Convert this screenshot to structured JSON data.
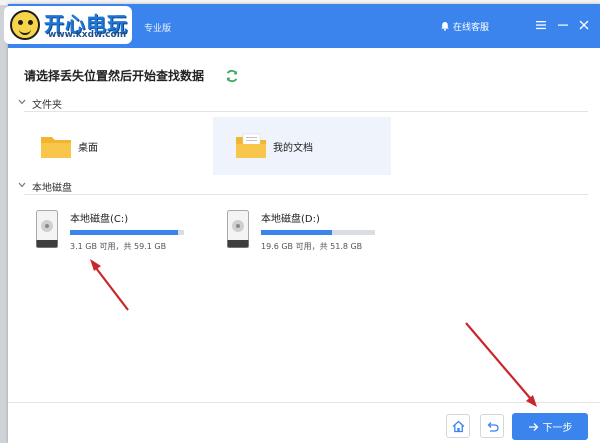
{
  "app": {
    "logo_text": "开心电玩",
    "logo_url": "www.kxdw.com",
    "edition": "专业版",
    "online_service": "在线客服"
  },
  "main": {
    "heading": "请选择丢失位置然后开始查找数据"
  },
  "folders": {
    "section_label": "文件夹",
    "items": [
      {
        "label": "桌面",
        "selected": false
      },
      {
        "label": "我的文档",
        "selected": true
      }
    ]
  },
  "disks": {
    "section_label": "本地磁盘",
    "items": [
      {
        "name": "本地磁盘(C:)",
        "info": "3.1 GB 可用，共 59.1 GB",
        "used_fraction": 0.95
      },
      {
        "name": "本地磁盘(D:)",
        "info": "19.6 GB 可用，共 51.8 GB",
        "used_fraction": 0.62
      }
    ]
  },
  "footer": {
    "next_label": "下一步"
  },
  "colors": {
    "accent": "#3b84ee",
    "annotation_arrow": "#c8282b",
    "folder_yellow": "#f7c64a"
  }
}
